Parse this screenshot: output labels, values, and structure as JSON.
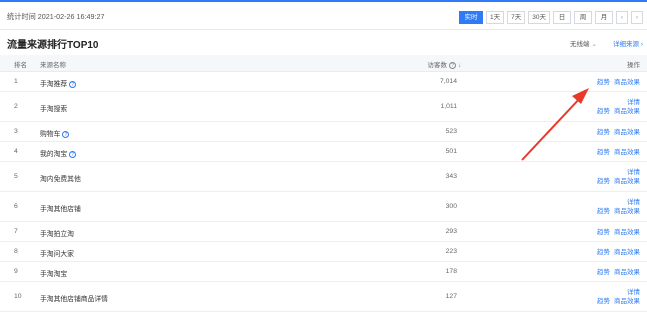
{
  "topbar": {
    "stat_time": "统计时间 2021-02-26 16:49:27",
    "buttons": [
      "实时",
      "1天",
      "7天",
      "30天",
      "日",
      "周",
      "月"
    ],
    "active_index": 0,
    "prev_icon": "chevron-left-icon",
    "next_icon": "chevron-right-icon"
  },
  "section": {
    "title": "流量来源排行TOP10",
    "device_select": "无线端",
    "detail_link": "详细来源"
  },
  "table": {
    "headers": {
      "rank": "排名",
      "source": "来源名称",
      "visitors": "访客数",
      "ops": "操作"
    },
    "rows": [
      {
        "rank": "1",
        "source": "手淘推荐",
        "help": true,
        "visitors": "7,014",
        "detail": "",
        "trend": "趋势",
        "effect": "商品效果"
      },
      {
        "rank": "2",
        "source": "手淘搜索",
        "help": false,
        "visitors": "1,011",
        "detail": "详情",
        "trend": "趋势",
        "effect": "商品效果"
      },
      {
        "rank": "3",
        "source": "购物车",
        "help": true,
        "visitors": "523",
        "detail": "",
        "trend": "趋势",
        "effect": "商品效果"
      },
      {
        "rank": "4",
        "source": "我的淘宝",
        "help": true,
        "visitors": "501",
        "detail": "",
        "trend": "趋势",
        "effect": "商品效果"
      },
      {
        "rank": "5",
        "source": "淘内免费其他",
        "help": false,
        "visitors": "343",
        "detail": "详情",
        "trend": "趋势",
        "effect": "商品效果"
      },
      {
        "rank": "6",
        "source": "手淘其他店铺",
        "help": false,
        "visitors": "300",
        "detail": "详情",
        "trend": "趋势",
        "effect": "商品效果"
      },
      {
        "rank": "7",
        "source": "手淘拍立淘",
        "help": false,
        "visitors": "293",
        "detail": "",
        "trend": "趋势",
        "effect": "商品效果"
      },
      {
        "rank": "8",
        "source": "手淘问大家",
        "help": false,
        "visitors": "223",
        "detail": "",
        "trend": "趋势",
        "effect": "商品效果"
      },
      {
        "rank": "9",
        "source": "手淘淘宝",
        "help": false,
        "visitors": "178",
        "detail": "",
        "trend": "趋势",
        "effect": "商品效果"
      },
      {
        "rank": "10",
        "source": "手淘其他店铺商品详情",
        "help": false,
        "visitors": "127",
        "detail": "详情",
        "trend": "趋势",
        "effect": "商品效果"
      }
    ]
  },
  "annotation": {
    "arrow_color": "#e8392b"
  },
  "colors": {
    "accent": "#2f7bf5"
  }
}
